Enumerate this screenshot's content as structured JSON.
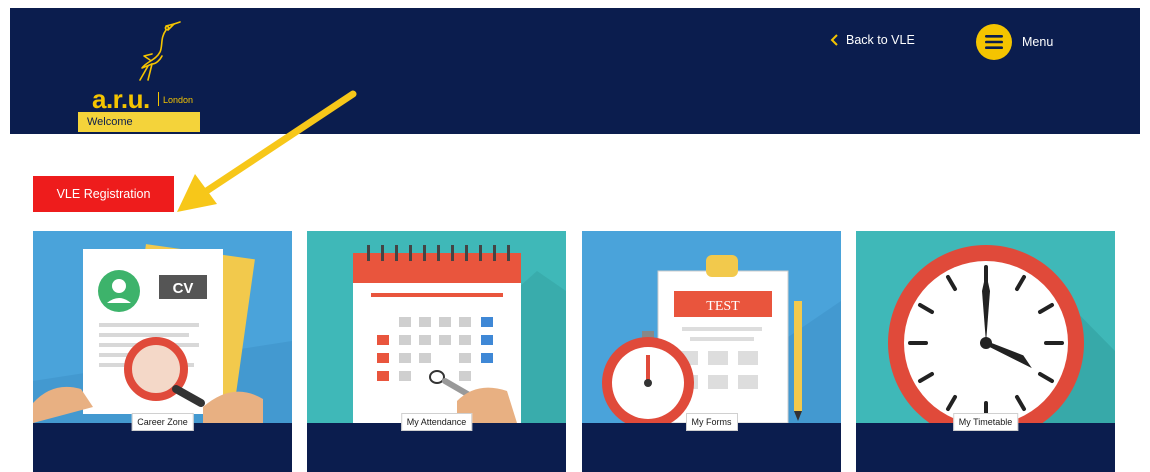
{
  "header": {
    "logo_text": "a.r.u.",
    "logo_sub": "London",
    "welcome": "Welcome",
    "back_label": "Back to VLE",
    "menu_label": "Menu"
  },
  "registration_button": "VLE Registration",
  "tiles": [
    {
      "label": "Career Zone",
      "cv_text": "CV"
    },
    {
      "label": "My Attendance"
    },
    {
      "label": "My Forms",
      "sheet_text": "TEST"
    },
    {
      "label": "My Timetable"
    }
  ],
  "colors": {
    "navy": "#0b1d4e",
    "yellow": "#f4c400",
    "red": "#ee1c1c"
  }
}
